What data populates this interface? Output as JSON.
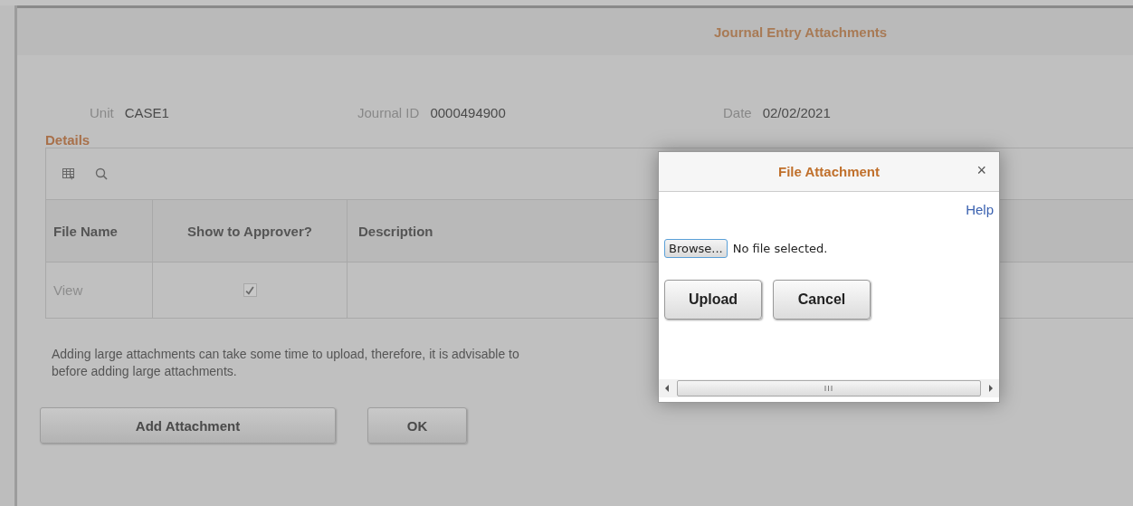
{
  "page": {
    "title": "Journal Entry Attachments",
    "fields": [
      {
        "label": "Unit",
        "value": "CASE1"
      },
      {
        "label": "Journal ID",
        "value": "0000494900"
      },
      {
        "label": "Date",
        "value": "02/02/2021"
      }
    ],
    "details": {
      "heading": "Details",
      "columns": [
        "File Name",
        "Show to Approver?",
        "Description"
      ],
      "rows": [
        {
          "file_name": "View",
          "show_to_approver": {
            "checked": true,
            "disabled": true
          }
        }
      ]
    },
    "notice": [
      "Adding large attachments can take some time to upload, therefore, it is advisable to",
      "before adding large attachments."
    ],
    "buttons": [
      "Add Attachment",
      "OK"
    ]
  },
  "dialog": {
    "title": "File Attachment",
    "close": "×",
    "help": "Help",
    "browse": "Browse...",
    "file_status": "No file selected.",
    "buttons": [
      "Upload",
      "Cancel"
    ],
    "scroll_grip": "III"
  }
}
